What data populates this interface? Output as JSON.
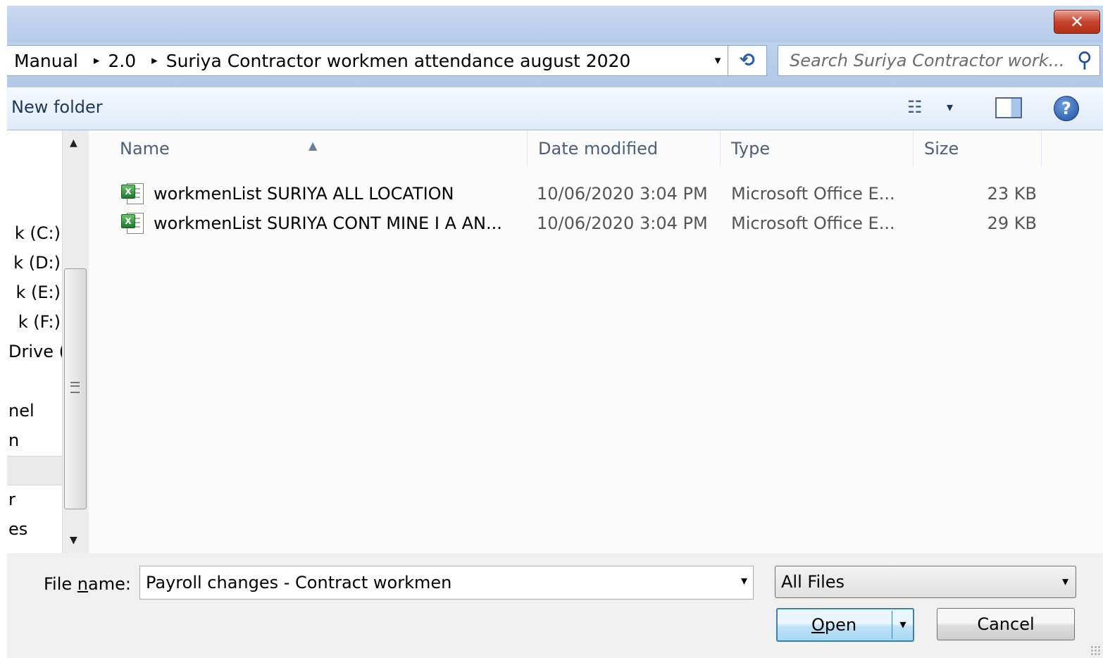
{
  "window": {
    "close_glyph": "✕"
  },
  "address_bar": {
    "crumbs": [
      "Manual",
      "2.0",
      "Suriya Contractor workmen attendance august 2020"
    ],
    "separator_glyph": "▸",
    "dropdown_glyph": "▾",
    "refresh_icon": "refresh-icon"
  },
  "search": {
    "placeholder": "Search Suriya Contractor work...",
    "icon": "search-icon"
  },
  "toolbar": {
    "new_folder_label": "New folder",
    "views_icon": "views-icon",
    "preview_pane_icon": "preview-pane-icon",
    "help_glyph": "?"
  },
  "nav_pane": {
    "items": [
      "k (C:)",
      "k (D:)",
      "k (E:)",
      "k (F:)",
      "Drive (",
      "nel",
      "n",
      "r",
      "es"
    ]
  },
  "file_list": {
    "columns": [
      "Name",
      "Date modified",
      "Type",
      "Size"
    ],
    "sort_glyph": "▲",
    "rows": [
      {
        "name": "workmenList SURIYA ALL LOCATION",
        "date": "10/06/2020 3:04 PM",
        "type": "Microsoft Office E...",
        "size": "23 KB"
      },
      {
        "name": "workmenList SURIYA CONT MINE I A AN...",
        "date": "10/06/2020 3:04 PM",
        "type": "Microsoft Office E...",
        "size": "29 KB"
      }
    ],
    "file_badge": "X"
  },
  "bottom": {
    "file_name_label_pre": "File ",
    "file_name_label_u": "n",
    "file_name_label_post": "ame:",
    "file_name_value": "Payroll changes - Contract workmen",
    "file_type_selected": "All Files",
    "open_label_u": "O",
    "open_label_rest": "pen",
    "cancel_label": "Cancel",
    "dropdown_glyph": "▾",
    "scroll_up_glyph": "▲",
    "scroll_down_glyph": "▼"
  },
  "colors": {
    "title_gradient": "#c9daf0",
    "close_red": "#c6442e",
    "header_text": "#4c607a",
    "open_button_border": "#3c7fb1"
  }
}
